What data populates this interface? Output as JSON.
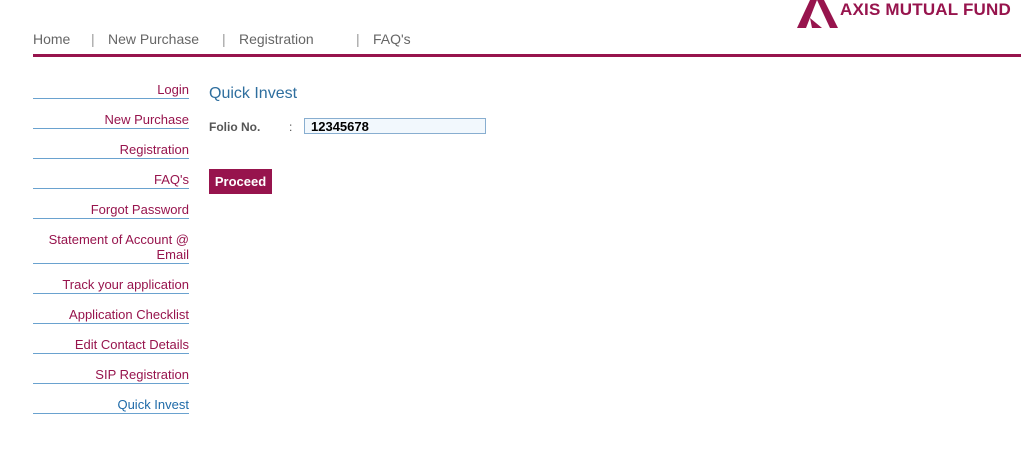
{
  "brand": {
    "name": "AXIS MUTUAL FUND",
    "color": "#97144d",
    "logo_icon": "axis-triangle-icon"
  },
  "topnav": {
    "items": [
      {
        "label": "Home"
      },
      {
        "label": "New Purchase"
      },
      {
        "label": "Registration"
      },
      {
        "label": "FAQ's"
      }
    ],
    "separator": "|"
  },
  "sidebar": {
    "items": [
      {
        "label": "Login"
      },
      {
        "label": "New Purchase"
      },
      {
        "label": "Registration"
      },
      {
        "label": "FAQ's"
      },
      {
        "label": "Forgot Password"
      },
      {
        "label": "Statement of Account @ Email"
      },
      {
        "label": "Track your application"
      },
      {
        "label": "Application Checklist"
      },
      {
        "label": "Edit Contact Details"
      },
      {
        "label": "SIP Registration"
      },
      {
        "label": "Quick Invest"
      }
    ],
    "active": "Quick Invest"
  },
  "main": {
    "title": "Quick Invest",
    "folio": {
      "label": "Folio No.",
      "colon": ":",
      "value": "12345678"
    },
    "proceed_label": "Proceed"
  }
}
